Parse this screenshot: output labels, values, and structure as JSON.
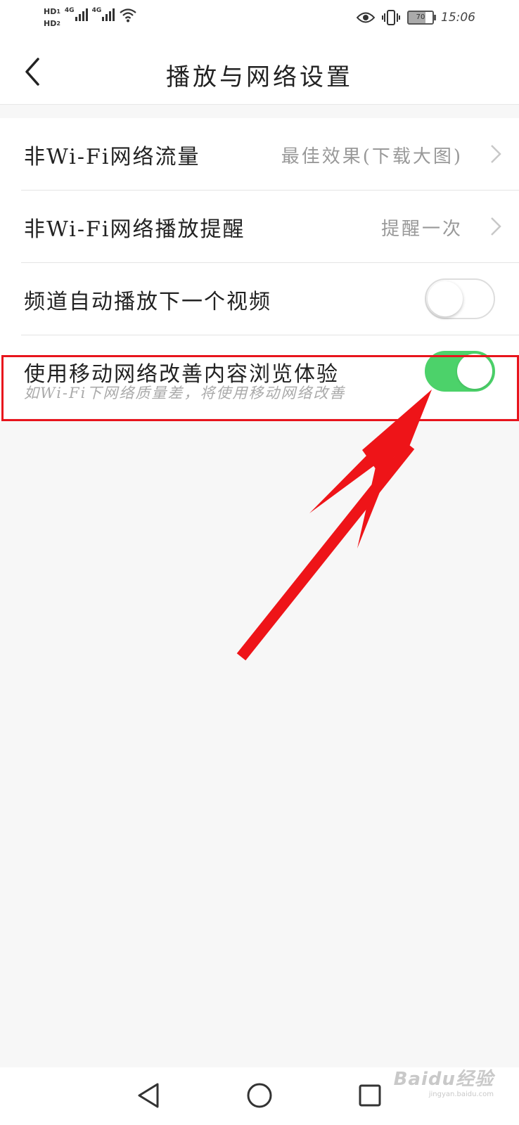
{
  "status_bar": {
    "hd1": "HD",
    "hd1_sub": "1",
    "hd2": "HD",
    "hd2_sub": "2",
    "sim1_type": "4G",
    "sim2_type": "4G",
    "battery": "70",
    "time": "15:06",
    "icons": [
      "signal-icon",
      "wifi-icon",
      "eye-icon",
      "vibrate-icon",
      "battery-icon"
    ]
  },
  "header": {
    "title": "播放与网络设置"
  },
  "settings": {
    "items": [
      {
        "label": "非Wi-Fi网络流量",
        "value": "最佳效果(下载大图)"
      },
      {
        "label": "非Wi-Fi网络播放提醒",
        "value": "提醒一次"
      },
      {
        "label": "频道自动播放下一个视频",
        "toggle": false
      },
      {
        "label": "使用移动网络改善内容浏览体验",
        "sub": "如Wi-Fi下网络质量差，将使用移动网络改善",
        "toggle": true
      }
    ]
  },
  "colors": {
    "toggle_on": "#4cd26a",
    "annotation": "#e8141c",
    "background": "#f7f7f7"
  },
  "watermark": {
    "logo": "Baidu经验",
    "url": "jingyan.baidu.com"
  }
}
